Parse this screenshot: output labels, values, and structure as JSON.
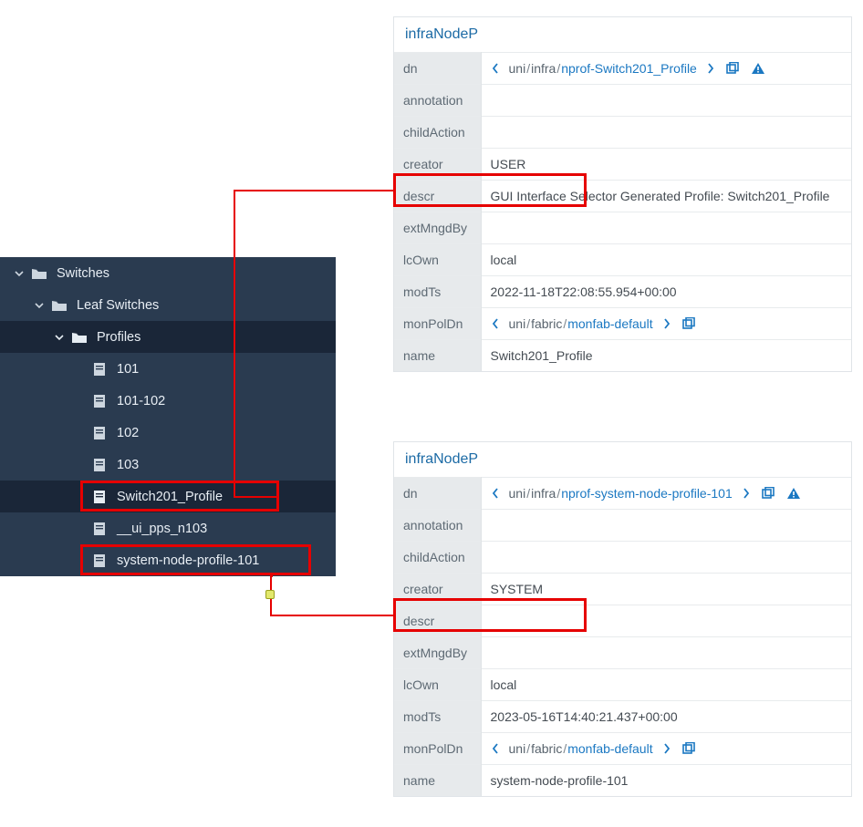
{
  "tree": {
    "root": {
      "label": "Switches",
      "child": {
        "label": "Leaf Switches",
        "child": {
          "label": "Profiles",
          "items": [
            {
              "label": "101"
            },
            {
              "label": "101-102"
            },
            {
              "label": "102"
            },
            {
              "label": "103"
            },
            {
              "label": "Switch201_Profile",
              "selected": true,
              "highlight": true
            },
            {
              "label": "__ui_pps_n103"
            },
            {
              "label": "system-node-profile-101",
              "highlight": true
            }
          ]
        }
      }
    }
  },
  "panel1": {
    "title": "infraNodeP",
    "rows": {
      "dn": {
        "seg0": "uni",
        "seg1": "infra",
        "seg2": "nprof-Switch201_Profile"
      },
      "annotation": "",
      "childAction": "",
      "creator": "USER",
      "descr": "GUI Interface Selector Generated Profile: Switch201_Profile",
      "extMngdBy": "",
      "lcOwn": "local",
      "modTs": "2022-11-18T22:08:55.954+00:00",
      "monPolDn": {
        "seg0": "uni",
        "seg1": "fabric",
        "seg2": "monfab-default"
      },
      "name": "Switch201_Profile"
    },
    "labels": {
      "dn": "dn",
      "annotation": "annotation",
      "childAction": "childAction",
      "creator": "creator",
      "descr": "descr",
      "extMngdBy": "extMngdBy",
      "lcOwn": "lcOwn",
      "modTs": "modTs",
      "monPolDn": "monPolDn",
      "name": "name"
    }
  },
  "panel2": {
    "title": "infraNodeP",
    "rows": {
      "dn": {
        "seg0": "uni",
        "seg1": "infra",
        "seg2": "nprof-system-node-profile-101"
      },
      "annotation": "",
      "childAction": "",
      "creator": "SYSTEM",
      "descr": "",
      "extMngdBy": "",
      "lcOwn": "local",
      "modTs": "2023-05-16T14:40:21.437+00:00",
      "monPolDn": {
        "seg0": "uni",
        "seg1": "fabric",
        "seg2": "monfab-default"
      },
      "name": "system-node-profile-101"
    },
    "labels": {
      "dn": "dn",
      "annotation": "annotation",
      "childAction": "childAction",
      "creator": "creator",
      "descr": "descr",
      "extMngdBy": "extMngdBy",
      "lcOwn": "lcOwn",
      "modTs": "modTs",
      "monPolDn": "monPolDn",
      "name": "name"
    }
  }
}
